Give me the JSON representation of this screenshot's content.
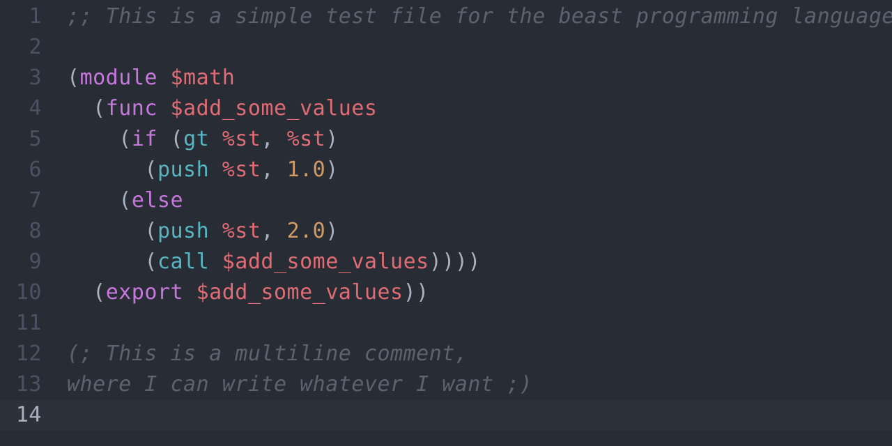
{
  "editor": {
    "active_line": 14,
    "colors": {
      "background": "#282c34",
      "active_line": "#2c313a",
      "gutter": "#4b5263",
      "comment": "#5c6370",
      "keyword": "#c678dd",
      "builtin": "#56b6c2",
      "variable": "#e06c75",
      "number": "#d19a66",
      "punctuation": "#abb2bf"
    },
    "lines": [
      {
        "number": "1",
        "tokens": [
          {
            "type": "comment",
            "text": ";; This is a simple test file for the beast programming language"
          }
        ]
      },
      {
        "number": "2",
        "tokens": []
      },
      {
        "number": "3",
        "tokens": [
          {
            "type": "punct",
            "text": "("
          },
          {
            "type": "keyword",
            "text": "module"
          },
          {
            "type": "punct",
            "text": " "
          },
          {
            "type": "variable",
            "text": "$math"
          }
        ]
      },
      {
        "number": "4",
        "tokens": [
          {
            "type": "punct",
            "text": "  ("
          },
          {
            "type": "keyword",
            "text": "func"
          },
          {
            "type": "punct",
            "text": " "
          },
          {
            "type": "variable",
            "text": "$add_some_values"
          }
        ]
      },
      {
        "number": "5",
        "tokens": [
          {
            "type": "punct",
            "text": "    ("
          },
          {
            "type": "keyword",
            "text": "if"
          },
          {
            "type": "punct",
            "text": " ("
          },
          {
            "type": "builtin",
            "text": "gt"
          },
          {
            "type": "punct",
            "text": " "
          },
          {
            "type": "variable",
            "text": "%st"
          },
          {
            "type": "punct",
            "text": ", "
          },
          {
            "type": "variable",
            "text": "%st"
          },
          {
            "type": "punct",
            "text": ")"
          }
        ]
      },
      {
        "number": "6",
        "tokens": [
          {
            "type": "punct",
            "text": "      ("
          },
          {
            "type": "builtin",
            "text": "push"
          },
          {
            "type": "punct",
            "text": " "
          },
          {
            "type": "variable",
            "text": "%st"
          },
          {
            "type": "punct",
            "text": ", "
          },
          {
            "type": "number",
            "text": "1.0"
          },
          {
            "type": "punct",
            "text": ")"
          }
        ]
      },
      {
        "number": "7",
        "tokens": [
          {
            "type": "punct",
            "text": "    ("
          },
          {
            "type": "keyword",
            "text": "else"
          }
        ]
      },
      {
        "number": "8",
        "tokens": [
          {
            "type": "punct",
            "text": "      ("
          },
          {
            "type": "builtin",
            "text": "push"
          },
          {
            "type": "punct",
            "text": " "
          },
          {
            "type": "variable",
            "text": "%st"
          },
          {
            "type": "punct",
            "text": ", "
          },
          {
            "type": "number",
            "text": "2.0"
          },
          {
            "type": "punct",
            "text": ")"
          }
        ]
      },
      {
        "number": "9",
        "tokens": [
          {
            "type": "punct",
            "text": "      ("
          },
          {
            "type": "builtin",
            "text": "call"
          },
          {
            "type": "punct",
            "text": " "
          },
          {
            "type": "variable",
            "text": "$add_some_values"
          },
          {
            "type": "punct",
            "text": "))))"
          }
        ]
      },
      {
        "number": "10",
        "tokens": [
          {
            "type": "punct",
            "text": "  ("
          },
          {
            "type": "keyword",
            "text": "export"
          },
          {
            "type": "punct",
            "text": " "
          },
          {
            "type": "variable",
            "text": "$add_some_values"
          },
          {
            "type": "punct",
            "text": "))"
          }
        ]
      },
      {
        "number": "11",
        "tokens": []
      },
      {
        "number": "12",
        "tokens": [
          {
            "type": "comment",
            "text": "(; This is a multiline comment,"
          }
        ]
      },
      {
        "number": "13",
        "tokens": [
          {
            "type": "comment",
            "text": "where I can write whatever I want ;)"
          }
        ]
      },
      {
        "number": "14",
        "tokens": []
      }
    ]
  }
}
